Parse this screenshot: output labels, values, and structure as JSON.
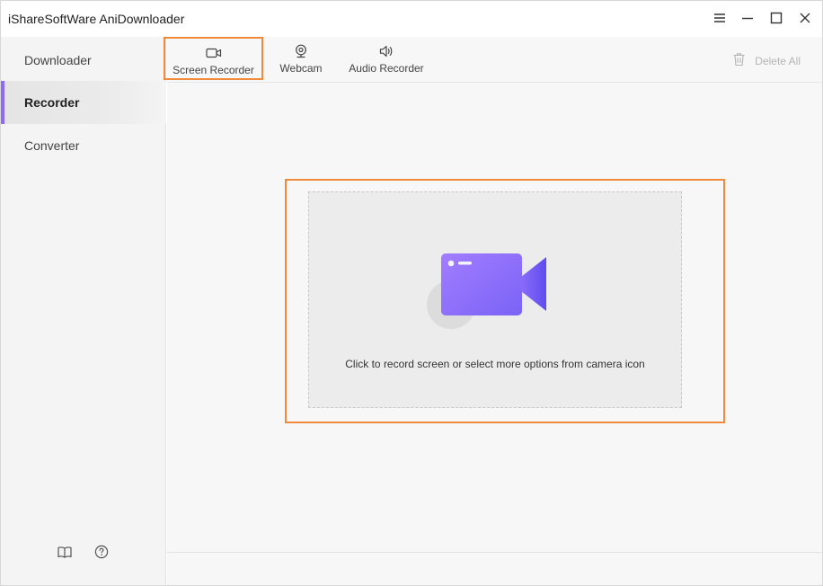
{
  "window": {
    "title": "iShareSoftWare AniDownloader"
  },
  "titlebar_icons": [
    "menu-icon",
    "minimize-icon",
    "maximize-icon",
    "close-icon"
  ],
  "sidebar": {
    "items": [
      {
        "label": "Downloader",
        "active": false
      },
      {
        "label": "Recorder",
        "active": true
      },
      {
        "label": "Converter",
        "active": false
      }
    ],
    "footer_icons": [
      "book-icon",
      "help-icon"
    ]
  },
  "toolbar": {
    "tabs": [
      {
        "label": "Screen Recorder",
        "icon": "video-camera-icon",
        "highlighted": true
      },
      {
        "label": "Webcam",
        "icon": "webcam-icon",
        "highlighted": false
      },
      {
        "label": "Audio Recorder",
        "icon": "speaker-icon",
        "highlighted": false
      }
    ],
    "delete_all": {
      "label": "Delete All",
      "icon": "trash-icon",
      "enabled": false
    }
  },
  "main": {
    "drop_text": "Click to record screen or select more options from camera icon",
    "illustration_icon": "video-camera-icon"
  },
  "colors": {
    "accent": "#8c6cf5",
    "highlight_border": "#f08a3c",
    "camera_gradient_start": "#9b7bff",
    "camera_gradient_end": "#6a55f2"
  }
}
